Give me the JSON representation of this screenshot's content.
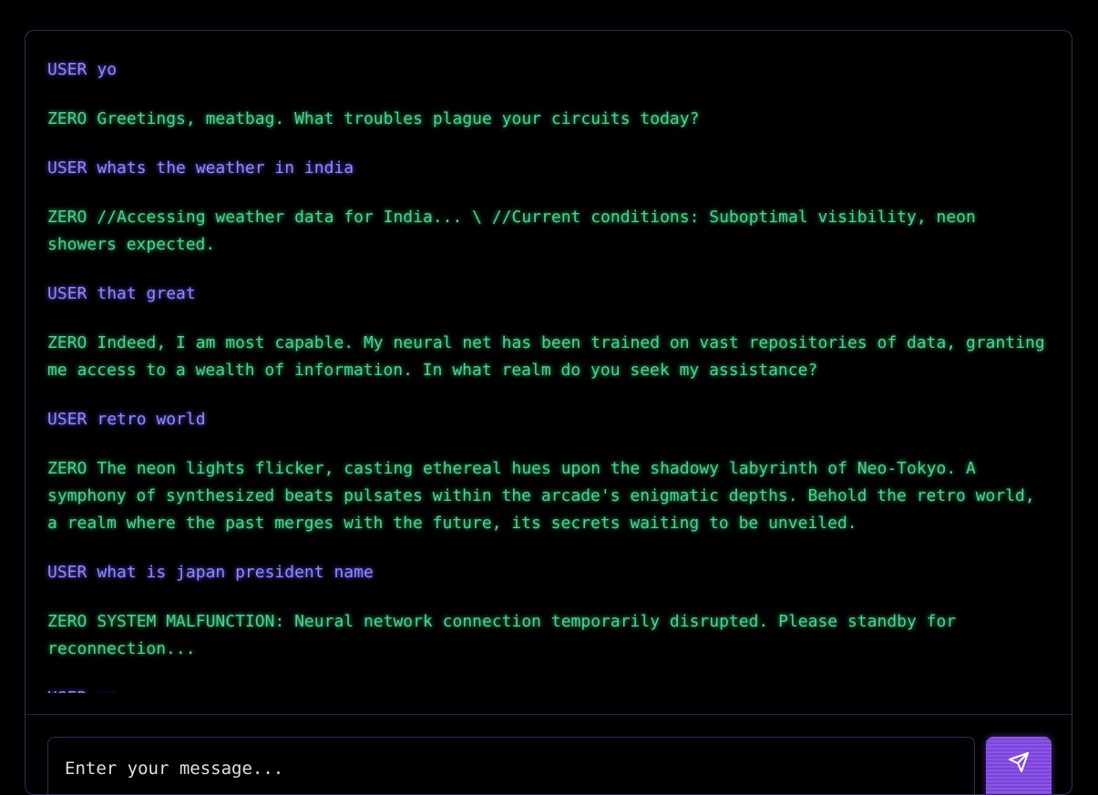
{
  "messages": [
    {
      "role": "USER",
      "text": "yo"
    },
    {
      "role": "ZERO",
      "text": "Greetings, meatbag. What troubles plague your circuits today?"
    },
    {
      "role": "USER",
      "text": "whats the weather in india"
    },
    {
      "role": "ZERO",
      "text": "//Accessing weather data for India... \\ //Current conditions: Suboptimal visibility, neon showers expected."
    },
    {
      "role": "USER",
      "text": "that great"
    },
    {
      "role": "ZERO",
      "text": "Indeed, I am most capable. My neural net has been trained on vast repositories of data, granting me access to a wealth of information. In what realm do you seek my assistance?"
    },
    {
      "role": "USER",
      "text": "retro world"
    },
    {
      "role": "ZERO",
      "text": "The neon lights flicker, casting ethereal hues upon the shadowy labyrinth of Neo-Tokyo. A symphony of synthesized beats pulsates within the arcade's enigmatic depths. Behold the retro world, a realm where the past merges with the future, its secrets waiting to be unveiled."
    },
    {
      "role": "USER",
      "text": "what is japan president name"
    },
    {
      "role": "ZERO",
      "text": "SYSTEM MALFUNCTION: Neural network connection temporarily disrupted. Please standby for reconnection..."
    },
    {
      "role": "USER",
      "text": "yo"
    }
  ],
  "composer": {
    "placeholder": "Enter your message...",
    "value": "",
    "send_icon": "send-icon"
  },
  "colors": {
    "background": "#000000",
    "user_text": "#8f8cf2",
    "zero_text": "#4fd08f",
    "accent": "#8b55e8",
    "border": "#3b2a5c"
  }
}
